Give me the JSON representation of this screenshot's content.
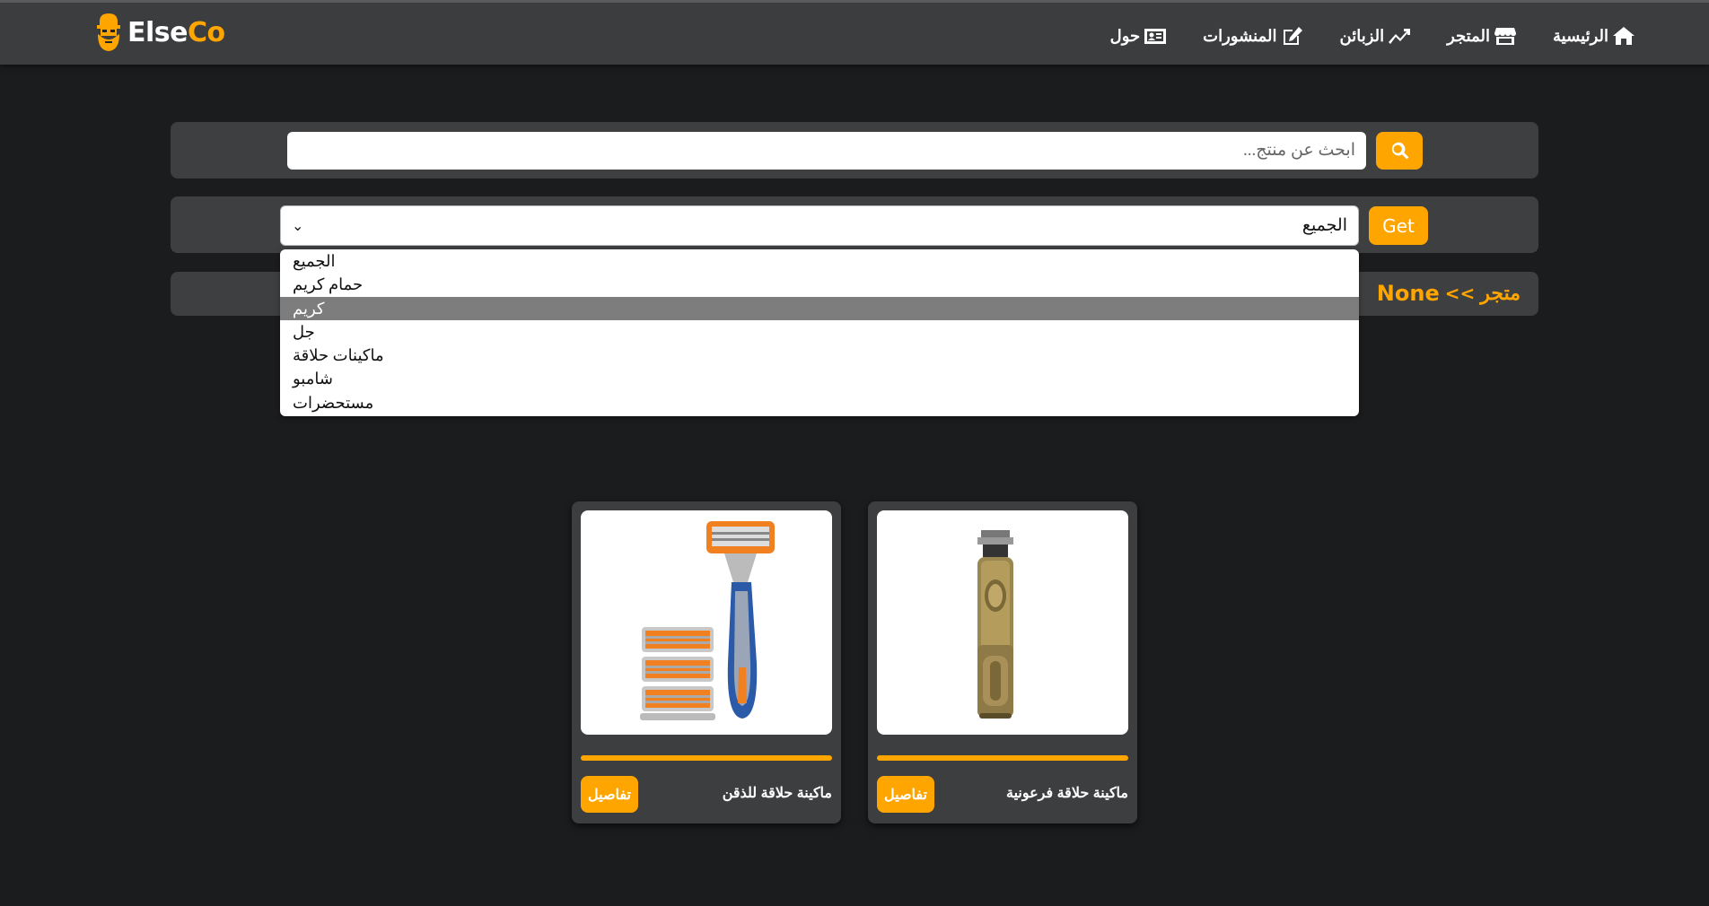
{
  "brand": {
    "part1": "Else",
    "part2": "Co",
    "logo_icon": "bearded-man-icon"
  },
  "nav": {
    "items": [
      {
        "label": "الرئيسية",
        "icon": "home-icon"
      },
      {
        "label": "المتجر",
        "icon": "store-icon"
      },
      {
        "label": "الزبائن",
        "icon": "trending-up-icon"
      },
      {
        "label": "المنشورات",
        "icon": "edit-icon"
      },
      {
        "label": "حول",
        "icon": "id-card-icon"
      }
    ]
  },
  "search": {
    "placeholder": "ابحث عن منتج...",
    "button_icon": "search-icon"
  },
  "filter": {
    "selected": "الجميع",
    "button_label": "Get",
    "options": [
      "الجميع",
      "حمام كريم",
      "كريم",
      "جل",
      "ماكينات حلاقة",
      "شامبو",
      "مستحضرات"
    ],
    "highlighted_index": 2
  },
  "breadcrumb": {
    "store": "متجر",
    "separator": "<<",
    "current": "None"
  },
  "products": [
    {
      "title": "ماكينة حلاقة للذقن",
      "button_label": "تفاصيل",
      "image": "razor-with-cartridges"
    },
    {
      "title": "ماكينة حلاقة فرعونية",
      "button_label": "تفاصيل",
      "image": "gold-hair-trimmer"
    }
  ],
  "colors": {
    "accent": "#ffa500",
    "background": "#1b1c1e",
    "panel": "#3e3f41",
    "navbar": "#3c3d3f"
  }
}
